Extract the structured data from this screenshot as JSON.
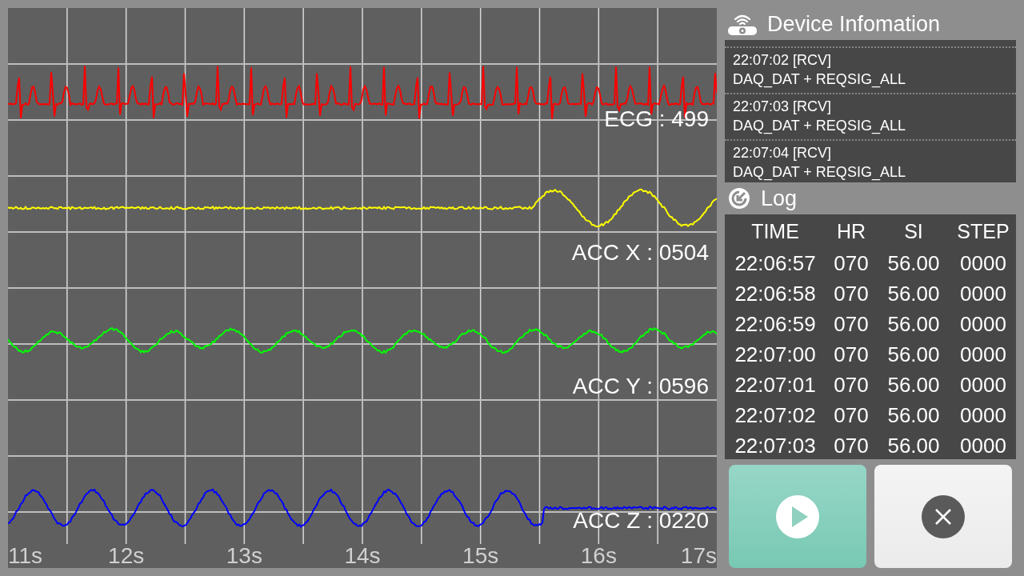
{
  "waveforms": {
    "channels": [
      {
        "label": "ECG : 499",
        "color": "#ff0000"
      },
      {
        "label": "ACC X : 0504",
        "color": "#ffff00"
      },
      {
        "label": "ACC Y : 0596",
        "color": "#00ff00"
      },
      {
        "label": "ACC Z : 0220",
        "color": "#0000ff"
      }
    ],
    "xticks": [
      "11s",
      "12s",
      "13s",
      "14s",
      "15s",
      "16s",
      "17s"
    ]
  },
  "device_info": {
    "title": "Device Infomation",
    "entries": [
      {
        "time": "22:07:02 [RCV]",
        "message": "DAQ_DAT + REQSIG_ALL"
      },
      {
        "time": "22:07:03 [RCV]",
        "message": "DAQ_DAT + REQSIG_ALL"
      },
      {
        "time": "22:07:04 [RCV]",
        "message": "DAQ_DAT + REQSIG_ALL"
      }
    ]
  },
  "log": {
    "title": "Log",
    "columns": [
      "TIME",
      "HR",
      "SI",
      "STEP"
    ],
    "rows": [
      [
        "22:06:57",
        "070",
        "56.00",
        "0000"
      ],
      [
        "22:06:58",
        "070",
        "56.00",
        "0000"
      ],
      [
        "22:06:59",
        "070",
        "56.00",
        "0000"
      ],
      [
        "22:07:00",
        "070",
        "56.00",
        "0000"
      ],
      [
        "22:07:01",
        "070",
        "56.00",
        "0000"
      ],
      [
        "22:07:02",
        "070",
        "56.00",
        "0000"
      ],
      [
        "22:07:03",
        "070",
        "56.00",
        "0000"
      ]
    ]
  },
  "buttons": [
    {
      "kind": "play"
    },
    {
      "kind": "close"
    }
  ]
}
